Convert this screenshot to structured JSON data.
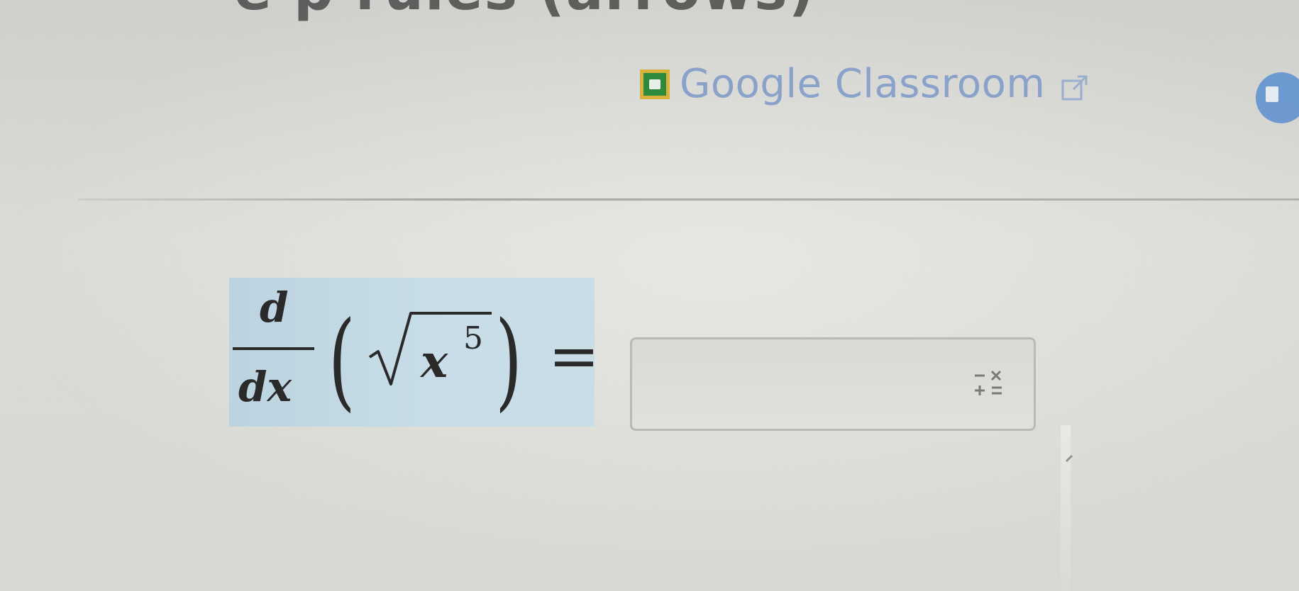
{
  "header": {
    "title_fragment": "e    p    rules (arrows)"
  },
  "classroom_link": {
    "label": "Google Classroom",
    "icon": "google-classroom-icon",
    "external_icon": "external-link-icon",
    "link_color": "#8aa2c9"
  },
  "problem": {
    "operator_numerator": "d",
    "operator_denominator": "dx",
    "open_paren": "(",
    "close_paren": ")",
    "radicand_base": "x",
    "radicand_exponent": "5",
    "equals": "=",
    "highlight_color": "#c3d9e4"
  },
  "answer": {
    "value": "",
    "placeholder": ""
  },
  "keypad": {
    "icon": "math-keypad-icon"
  },
  "share": {
    "icon": "share-badge-icon"
  }
}
